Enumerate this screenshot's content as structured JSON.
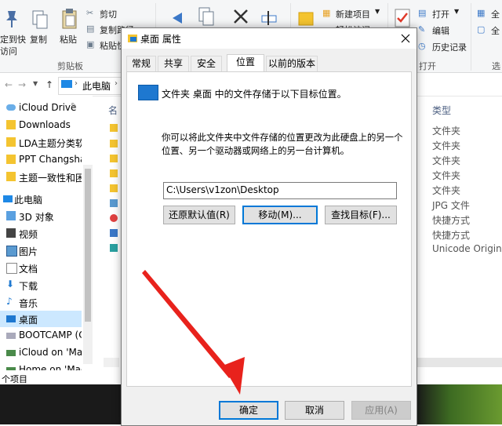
{
  "ribbon": {
    "pin_label_1": "定到快",
    "pin_label_2": "访问",
    "copy": "复制",
    "paste": "粘贴",
    "cut": "剪切",
    "copy_path": "复制路径",
    "paste_shortcut": "粘贴快",
    "clipboard_group": "剪贴板",
    "new_item": "新建项目",
    "easy_access": "轻松访问",
    "open": "打开",
    "edit": "编辑",
    "history": "历史记录",
    "open_group": "打开",
    "select_all": "全",
    "select_none": "全",
    "select_group": "选"
  },
  "address": {
    "path": "此电脑"
  },
  "nav": {
    "items": [
      {
        "label": "iCloud Drive",
        "icon": "cloud-icon"
      },
      {
        "label": "Downloads",
        "icon": "folder-icon"
      },
      {
        "label": "LDA主题分类软件",
        "icon": "folder-icon"
      },
      {
        "label": "PPT Changsha",
        "icon": "folder-icon"
      },
      {
        "label": "主题一致性和困惑",
        "icon": "folder-icon"
      },
      {
        "label": "此电脑",
        "icon": "computer-icon"
      },
      {
        "label": "3D 对象",
        "icon": "cube-icon"
      },
      {
        "label": "视频",
        "icon": "video-icon"
      },
      {
        "label": "图片",
        "icon": "picture-icon"
      },
      {
        "label": "文档",
        "icon": "document-icon"
      },
      {
        "label": "下载",
        "icon": "download-icon"
      },
      {
        "label": "音乐",
        "icon": "music-icon"
      },
      {
        "label": "桌面",
        "icon": "desktop-icon"
      },
      {
        "label": "BOOTCAMP (C:)",
        "icon": "drive-icon"
      },
      {
        "label": "iCloud on 'Mac'",
        "icon": "drive-icon"
      },
      {
        "label": "Home on 'Mac'",
        "icon": "drive-icon"
      }
    ]
  },
  "list": {
    "name_header": "名",
    "type_header": "类型",
    "types": [
      "文件夹",
      "文件夹",
      "文件夹",
      "文件夹",
      "文件夹",
      "JPG 文件",
      "快捷方式",
      "快捷方式",
      "Unicode Origin G"
    ]
  },
  "status": {
    "count": "个项目"
  },
  "dialog": {
    "title": "桌面 属性",
    "tabs": [
      "常规",
      "共享",
      "安全",
      "位置",
      "以前的版本"
    ],
    "active_tab": "位置",
    "heading": "文件夹 桌面 中的文件存储于以下目标位置。",
    "description_line1": "你可以将此文件夹中文件存储的位置更改为此硬盘上的另一个",
    "description_line2": "位置、另一个驱动器或网络上的另一台计算机。",
    "path_value": "C:\\Users\\v1zon\\Desktop",
    "restore_btn": "还原默认值(R)",
    "move_btn": "移动(M)...",
    "find_btn": "查找目标(F)...",
    "ok_btn": "确定",
    "cancel_btn": "取消",
    "apply_btn": "应用(A)",
    "accent": "#0078d7"
  },
  "annotation": {
    "arrow_color": "#e8221c"
  }
}
